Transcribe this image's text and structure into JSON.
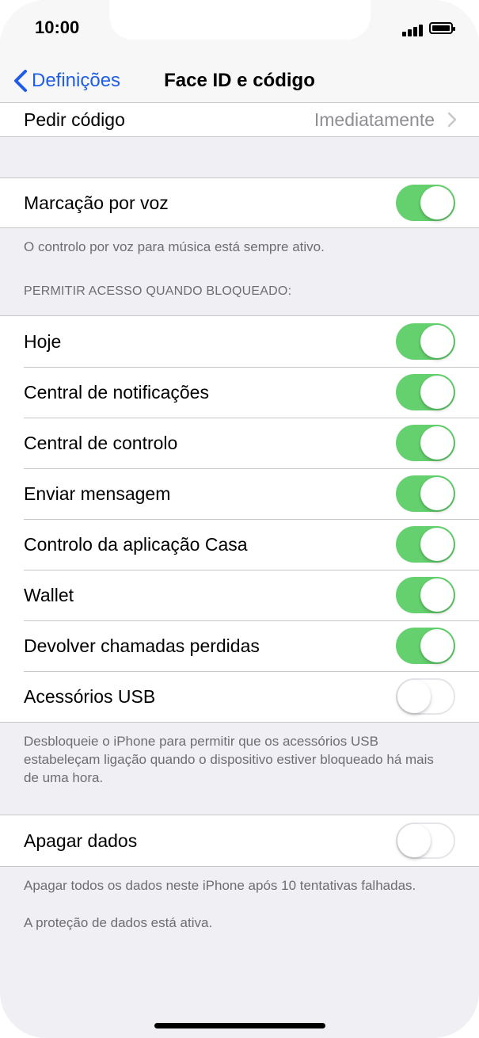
{
  "status_bar": {
    "time": "10:00"
  },
  "nav": {
    "back_label": "Definições",
    "title": "Face ID e código"
  },
  "passcode": {
    "label": "Pedir código",
    "value": "Imediatamente"
  },
  "voice_dial": {
    "label": "Marcação por voz",
    "on": true,
    "footer": "O controlo por voz para música está sempre ativo."
  },
  "locked_access": {
    "header": "PERMITIR ACESSO QUANDO BLOQUEADO:",
    "items": [
      {
        "label": "Hoje",
        "on": true
      },
      {
        "label": "Central de notificações",
        "on": true
      },
      {
        "label": "Central de controlo",
        "on": true
      },
      {
        "label": "Enviar mensagem",
        "on": true
      },
      {
        "label": "Controlo da aplicação Casa",
        "on": true
      },
      {
        "label": "Wallet",
        "on": true
      },
      {
        "label": "Devolver chamadas perdidas",
        "on": true
      },
      {
        "label": "Acessórios USB",
        "on": false
      }
    ],
    "footer": "Desbloqueie o iPhone para permitir que os acessórios USB estabeleçam ligação quando o dispositivo estiver bloqueado há mais de uma hora."
  },
  "erase_data": {
    "label": "Apagar dados",
    "on": false,
    "footer_1": "Apagar todos os dados neste iPhone após 10 tentativas falhadas.",
    "footer_2": "A proteção de dados está ativa."
  },
  "colors": {
    "accent": "#1f5ce8",
    "toggle_on": "#65d16e",
    "background": "#efeff4"
  }
}
